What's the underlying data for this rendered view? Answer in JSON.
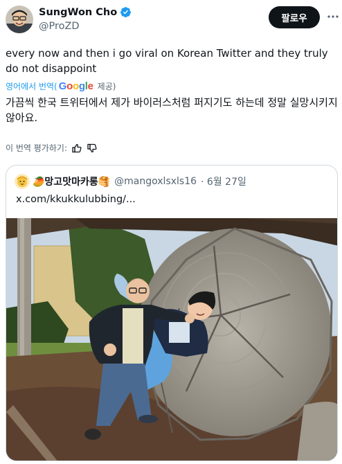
{
  "author": {
    "display_name": "SungWon Cho",
    "handle": "@ProZD",
    "verified": true
  },
  "follow_button": {
    "label": "팔로우"
  },
  "tweet": {
    "text": "every now and then i go viral on Korean Twitter and they truly do not disappoint",
    "translate_label": "영어에서 번역(",
    "translate_brand": "Google",
    "translate_provide": "제공)",
    "translated_text": "가끔씩 한국 트위터에서 제가 바이러스처럼 퍼지기도 하는데 정말 실망시키지 않아요.",
    "rate_label": "이 번역 평가하기:"
  },
  "quote": {
    "display_name": "🥭망고맛마카롱🥞",
    "handle": "@mangoxlsxls16",
    "date": "· 6월 27일",
    "body": "x.com/kkukkulubbing/..."
  },
  "icons": {
    "verified": "verified-badge-icon",
    "more": "more-icon",
    "thumbs_up": "thumbs-up-icon",
    "thumbs_down": "thumbs-down-icon"
  },
  "colors": {
    "accent": "#1d9bf0",
    "text": "#0f1419",
    "muted": "#536471",
    "border": "#cfd9de"
  }
}
